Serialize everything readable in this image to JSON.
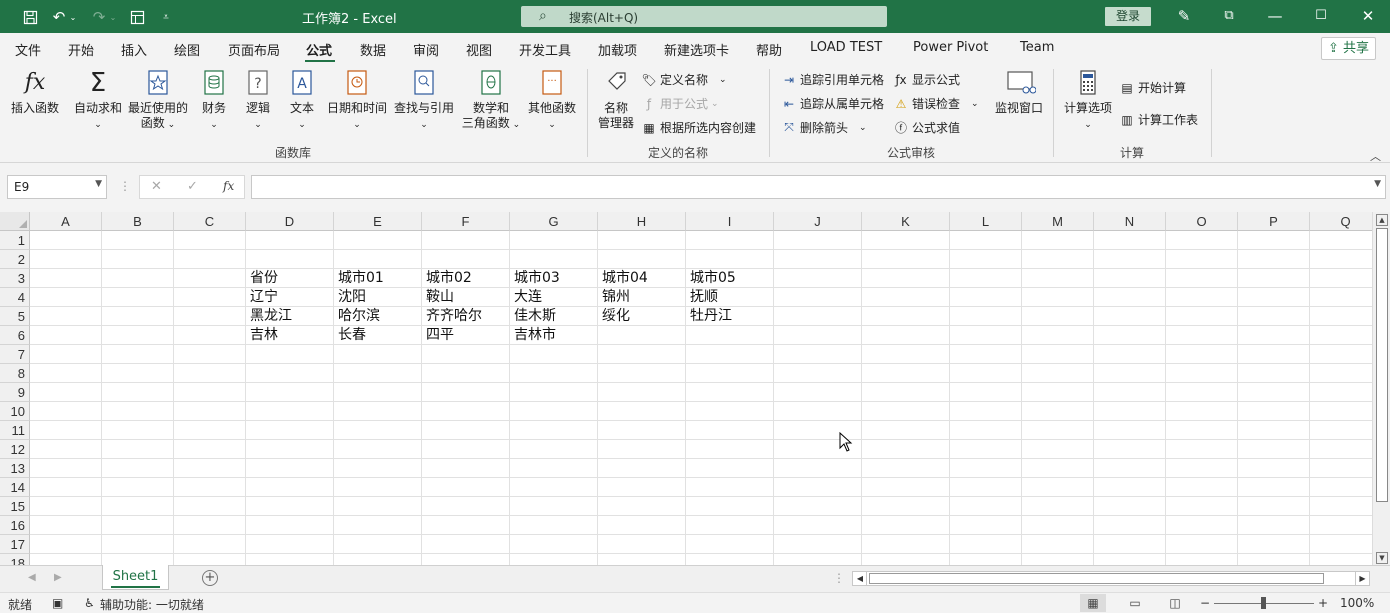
{
  "window": {
    "title": "工作簿2  -  Excel",
    "search_placeholder": "搜索(Alt+Q)",
    "login": "登录"
  },
  "menu": {
    "tabs": [
      "文件",
      "开始",
      "插入",
      "绘图",
      "页面布局",
      "公式",
      "数据",
      "审阅",
      "视图",
      "开发工具",
      "加载项",
      "新建选项卡",
      "帮助",
      "LOAD TEST",
      "Power Pivot",
      "Team"
    ],
    "active": "公式",
    "share": "共享"
  },
  "ribbon": {
    "function_library": {
      "label": "函数库",
      "insert_function": "插入函数",
      "autosum": "自动求和",
      "recent_line1": "最近使用的",
      "recent_line2": "函数",
      "finance": "财务",
      "logical": "逻辑",
      "text": "文本",
      "datetime": "日期和时间",
      "lookup": "查找与引用",
      "math_line1": "数学和",
      "math_line2": "三角函数",
      "other": "其他函数"
    },
    "defined_names": {
      "label": "定义的名称",
      "name_manager_line1": "名称",
      "name_manager_line2": "管理器",
      "define_name": "定义名称",
      "use_in_formula": "用于公式",
      "create_from_selection": "根据所选内容创建"
    },
    "formula_auditing": {
      "label": "公式审核",
      "trace_precedents": "追踪引用单元格",
      "trace_dependents": "追踪从属单元格",
      "remove_arrows": "删除箭头",
      "show_formulas": "显示公式",
      "error_checking": "错误检查",
      "evaluate_formula": "公式求值",
      "watch_window": "监视窗口"
    },
    "calculation": {
      "label": "计算",
      "calc_options": "计算选项",
      "calc_now": "开始计算",
      "calc_sheet": "计算工作表"
    }
  },
  "formula_bar": {
    "name_box": "E9",
    "fx": "fx",
    "content": ""
  },
  "grid": {
    "columns": [
      "A",
      "B",
      "C",
      "D",
      "E",
      "F",
      "G",
      "H",
      "I",
      "J",
      "K",
      "L",
      "M",
      "N",
      "O",
      "P",
      "Q"
    ],
    "rows": [
      "1",
      "2",
      "3",
      "4",
      "5",
      "6",
      "7",
      "8",
      "9",
      "10",
      "11",
      "12",
      "13",
      "14",
      "15",
      "16",
      "17",
      "18"
    ],
    "cells": [
      {
        "col": "D",
        "row": 3,
        "value": "省份"
      },
      {
        "col": "E",
        "row": 3,
        "value": "城市01"
      },
      {
        "col": "F",
        "row": 3,
        "value": "城市02"
      },
      {
        "col": "G",
        "row": 3,
        "value": "城市03"
      },
      {
        "col": "H",
        "row": 3,
        "value": "城市04"
      },
      {
        "col": "I",
        "row": 3,
        "value": "城市05"
      },
      {
        "col": "D",
        "row": 4,
        "value": "辽宁"
      },
      {
        "col": "E",
        "row": 4,
        "value": "沈阳"
      },
      {
        "col": "F",
        "row": 4,
        "value": "鞍山"
      },
      {
        "col": "G",
        "row": 4,
        "value": "大连"
      },
      {
        "col": "H",
        "row": 4,
        "value": "锦州"
      },
      {
        "col": "I",
        "row": 4,
        "value": "抚顺"
      },
      {
        "col": "D",
        "row": 5,
        "value": "黑龙江"
      },
      {
        "col": "E",
        "row": 5,
        "value": "哈尔滨"
      },
      {
        "col": "F",
        "row": 5,
        "value": "齐齐哈尔"
      },
      {
        "col": "G",
        "row": 5,
        "value": "佳木斯"
      },
      {
        "col": "H",
        "row": 5,
        "value": "绥化"
      },
      {
        "col": "I",
        "row": 5,
        "value": "牡丹江"
      },
      {
        "col": "D",
        "row": 6,
        "value": "吉林"
      },
      {
        "col": "E",
        "row": 6,
        "value": "长春"
      },
      {
        "col": "F",
        "row": 6,
        "value": "四平"
      },
      {
        "col": "G",
        "row": 6,
        "value": "吉林市"
      }
    ]
  },
  "sheets": {
    "tabs": [
      "Sheet1"
    ],
    "active": "Sheet1"
  },
  "status": {
    "ready": "就绪",
    "accessibility": "辅助功能: 一切就绪",
    "zoom": "100%"
  },
  "colors": {
    "brand": "#217346",
    "ribbon_bg": "#f3f3f3"
  }
}
